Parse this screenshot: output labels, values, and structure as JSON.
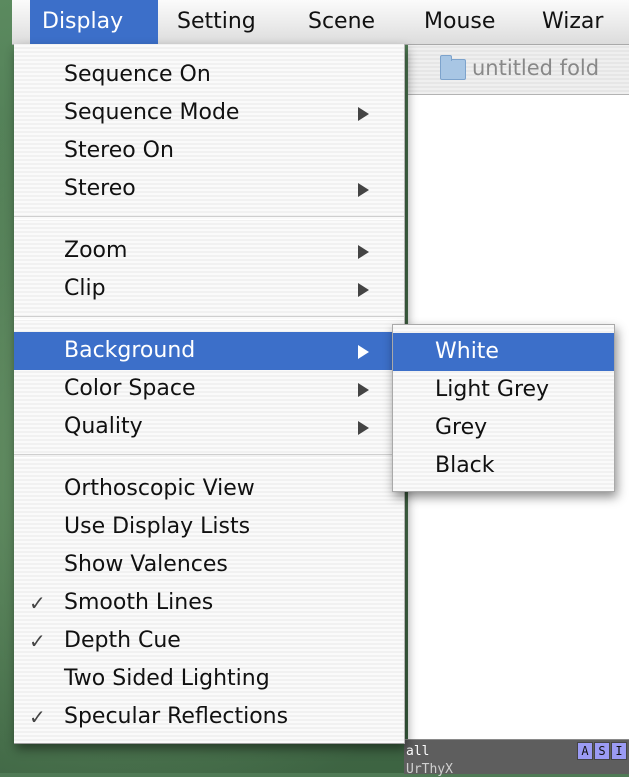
{
  "menubar": {
    "items": [
      {
        "label": "Display"
      },
      {
        "label": "Setting"
      },
      {
        "label": "Scene"
      },
      {
        "label": "Mouse"
      },
      {
        "label": "Wizar"
      }
    ]
  },
  "finder": {
    "title": "untitled fold",
    "folder_icon": "folder-icon"
  },
  "display_menu": {
    "items": [
      {
        "label": "Sequence On"
      },
      {
        "label": "Sequence Mode",
        "has_submenu": true
      },
      {
        "label": "Stereo On"
      },
      {
        "label": "Stereo",
        "has_submenu": true
      },
      {
        "label": "Zoom",
        "has_submenu": true
      },
      {
        "label": "Clip",
        "has_submenu": true
      },
      {
        "label": "Background",
        "has_submenu": true,
        "selected": true
      },
      {
        "label": "Color Space",
        "has_submenu": true
      },
      {
        "label": "Quality",
        "has_submenu": true
      },
      {
        "label": "Orthoscopic View"
      },
      {
        "label": "Use Display Lists"
      },
      {
        "label": "Show Valences"
      },
      {
        "label": "Smooth Lines",
        "checked": true
      },
      {
        "label": "Depth Cue",
        "checked": true
      },
      {
        "label": "Two Sided Lighting"
      },
      {
        "label": "Specular Reflections",
        "checked": true
      }
    ],
    "check_glyph": "✓"
  },
  "background_submenu": {
    "items": [
      {
        "label": "White",
        "selected": true
      },
      {
        "label": "Light Grey"
      },
      {
        "label": "Grey"
      },
      {
        "label": "Black"
      }
    ]
  },
  "console": {
    "row1": "all",
    "row2": "UrThyX",
    "buttons": [
      "A",
      "S",
      "I"
    ]
  },
  "colors": {
    "selection": "#3c6fc9",
    "desktop": "#4f7a55"
  }
}
